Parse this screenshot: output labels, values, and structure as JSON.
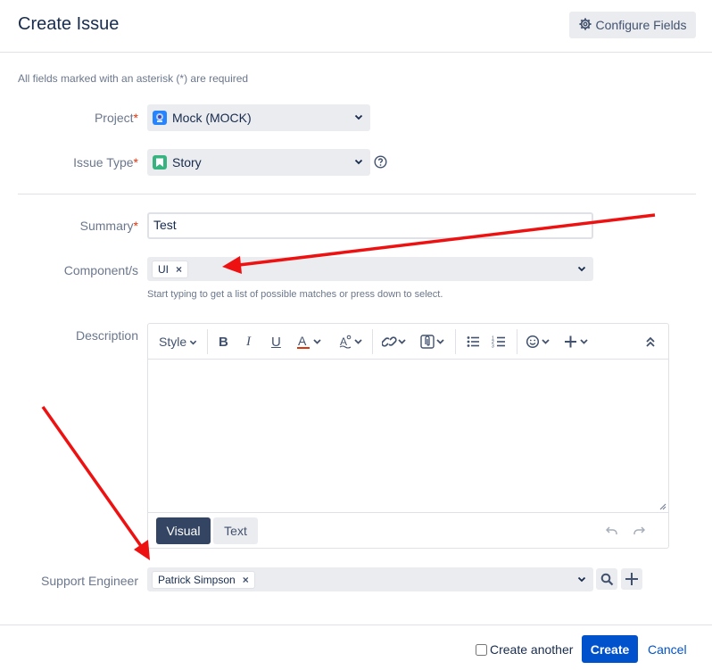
{
  "dialog": {
    "title": "Create Issue",
    "configure_fields_label": "Configure Fields",
    "required_note": "All fields marked with an asterisk (*) are required"
  },
  "fields": {
    "project": {
      "label": "Project",
      "required_mark": "*",
      "value": "Mock (MOCK)",
      "icon": "project-avatar-icon"
    },
    "issue_type": {
      "label": "Issue Type",
      "required_mark": "*",
      "value": "Story",
      "icon": "story-icon",
      "icon_color": "#36b37e"
    },
    "summary": {
      "label": "Summary",
      "required_mark": "*",
      "value": "Test"
    },
    "components": {
      "label": "Component/s",
      "chips": [
        "UI"
      ],
      "hint": "Start typing to get a list of possible matches or press down to select."
    },
    "description": {
      "label": "Description",
      "style_label": "Style",
      "mode_visual": "Visual",
      "mode_text": "Text",
      "toolbar_icons": [
        "bold-icon",
        "italic-icon",
        "underline-icon",
        "text-color-icon",
        "more-formatting-icon",
        "link-icon",
        "attachment-icon",
        "bullet-list-icon",
        "numbered-list-icon",
        "emoji-icon",
        "insert-more-icon",
        "collapse-toolbar-icon"
      ],
      "text_color_accent": "#de350b"
    },
    "support_engineer": {
      "label": "Support Engineer",
      "chips": [
        "Patrick Simpson"
      ]
    }
  },
  "footer": {
    "create_another_label": "Create another",
    "create_another_checked": false,
    "create_label": "Create",
    "cancel_label": "Cancel"
  },
  "colors": {
    "primary": "#0052cc",
    "text": "#172b4d",
    "muted": "#6b778c",
    "field_bg": "#ebecf0",
    "required": "#de350b",
    "annotation_arrow": "#ee1111"
  }
}
